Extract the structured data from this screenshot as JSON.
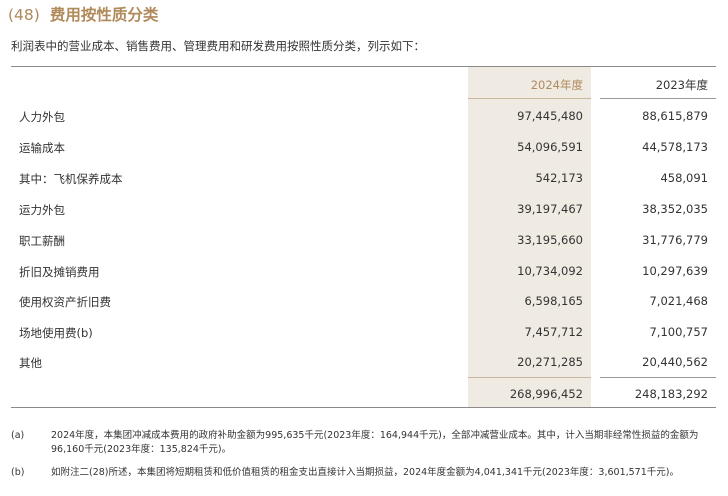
{
  "section": {
    "number": "(48)",
    "title": "费用按性质分类"
  },
  "intro": "利润表中的营业成本、销售费用、管理费用和研发费用按照性质分类，列示如下：",
  "columns": {
    "current": "2024年度",
    "previous": "2023年度"
  },
  "rows": [
    {
      "label": "人力外包",
      "current": "97,445,480",
      "previous": "88,615,879"
    },
    {
      "label": "运输成本",
      "current": "54,096,591",
      "previous": "44,578,173"
    },
    {
      "label": "其中：飞机保养成本",
      "current": "542,173",
      "previous": "458,091"
    },
    {
      "label": "运力外包",
      "current": "39,197,467",
      "previous": "38,352,035"
    },
    {
      "label": "职工薪酬",
      "current": "33,195,660",
      "previous": "31,776,779"
    },
    {
      "label": "折旧及摊销费用",
      "current": "10,734,092",
      "previous": "10,297,639"
    },
    {
      "label": "使用权资产折旧费",
      "current": "6,598,165",
      "previous": "7,021,468"
    },
    {
      "label": "场地使用费(b)",
      "current": "7,457,712",
      "previous": "7,100,757"
    },
    {
      "label": "其他",
      "current": "20,271,285",
      "previous": "20,440,562"
    }
  ],
  "total": {
    "current": "268,996,452",
    "previous": "248,183,292"
  },
  "notes": [
    {
      "marker": "(a)",
      "text": "2024年度，本集团冲减成本费用的政府补助金额为995,635千元(2023年度：164,944千元)，全部冲减营业成本。其中，计入当期非经常性损益的金额为96,160千元(2023年度：135,824千元)。"
    },
    {
      "marker": "(b)",
      "text": "如附注二(28)所述，本集团将短期租赁和低价值租赁的租金支出直接计入当期损益，2024年度金额为4,041,341千元(2023年度：3,601,571千元)。"
    }
  ],
  "colors": {
    "title": "#b08a5a",
    "current_column_shade": "#efeae2",
    "text": "#333333"
  }
}
